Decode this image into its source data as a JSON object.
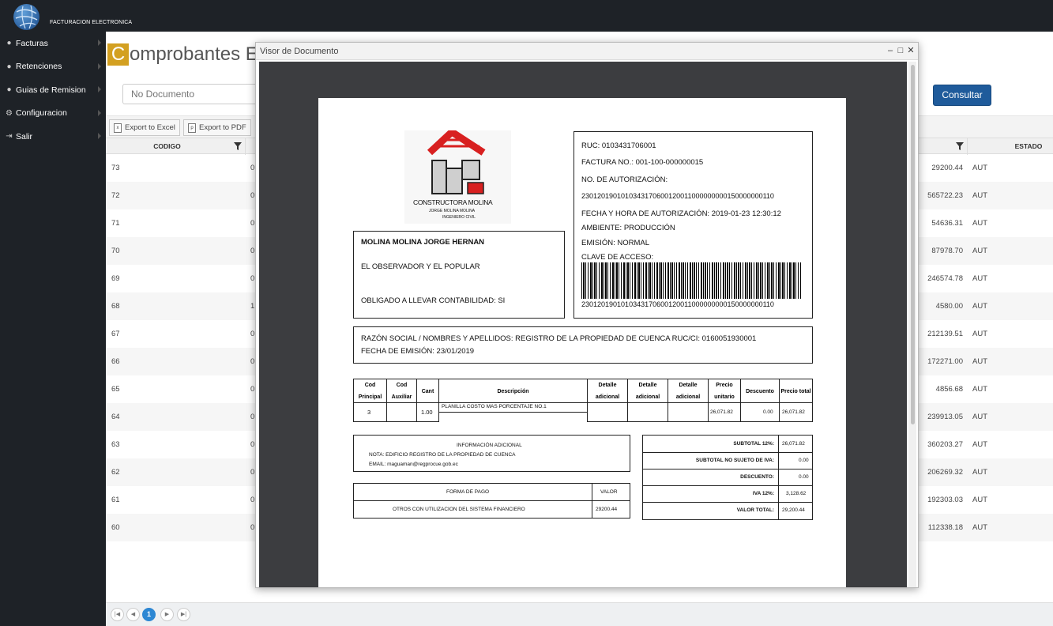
{
  "app": {
    "brand": "FACTURACION ELECTRONICA"
  },
  "sidebar": {
    "items": [
      {
        "label": "Facturas",
        "icon": "globe-icon"
      },
      {
        "label": "Retenciones",
        "icon": "globe-icon"
      },
      {
        "label": "Guias de Remision",
        "icon": "globe-icon"
      },
      {
        "label": "Configuracion",
        "icon": "gear-icon"
      },
      {
        "label": "Salir",
        "icon": "exit-icon"
      }
    ]
  },
  "page": {
    "title_initial": "C",
    "title_rest": "omprobantes E",
    "search_placeholder": "No Documento",
    "consultar_label": "Consultar",
    "export_excel": "Export to Excel",
    "export_pdf": "Export to PDF"
  },
  "grid": {
    "col_codigo": "CODIGO",
    "col_estado": "ESTADO",
    "rows": [
      {
        "codigo": "73",
        "doc": "0",
        "total": "29200.44",
        "estado": "AUT"
      },
      {
        "codigo": "72",
        "doc": "0",
        "total": "565722.23",
        "estado": "AUT"
      },
      {
        "codigo": "71",
        "doc": "0",
        "total": "54636.31",
        "estado": "AUT"
      },
      {
        "codigo": "70",
        "doc": "0",
        "total": "87978.70",
        "estado": "AUT"
      },
      {
        "codigo": "69",
        "doc": "0",
        "total": "246574.78",
        "estado": "AUT"
      },
      {
        "codigo": "68",
        "doc": "1",
        "total": "4580.00",
        "estado": "AUT"
      },
      {
        "codigo": "67",
        "doc": "0",
        "total": "212139.51",
        "estado": "AUT"
      },
      {
        "codigo": "66",
        "doc": "0",
        "total": "172271.00",
        "estado": "AUT"
      },
      {
        "codigo": "65",
        "doc": "0",
        "total": "4856.68",
        "estado": "AUT"
      },
      {
        "codigo": "64",
        "doc": "0",
        "total": "239913.05",
        "estado": "AUT"
      },
      {
        "codigo": "63",
        "doc": "0",
        "total": "360203.27",
        "estado": "AUT"
      },
      {
        "codigo": "62",
        "doc": "0",
        "total": "206269.32",
        "estado": "AUT"
      },
      {
        "codigo": "61",
        "doc": "0",
        "total": "192303.03",
        "estado": "AUT"
      },
      {
        "codigo": "60",
        "doc": "0",
        "total": "112338.18",
        "estado": "AUT"
      }
    ]
  },
  "pager": {
    "current": "1"
  },
  "modal": {
    "title": "Visor de Documento",
    "minimize": "–",
    "maximize": "□",
    "close": "✕"
  },
  "invoice": {
    "company_logo_name": "CONSTRUCTORA MOLINA",
    "company_logo_sub1": "JORGE MOLINA MOLINA",
    "company_logo_sub2": "INGENIERO CIVIL",
    "ruc": "RUC: 0103431706001",
    "factura_no": "FACTURA NO.: 001-100-000000015",
    "no_autorizacion_label": "NO. DE AUTORIZACIÓN:",
    "no_autorizacion": "2301201901010343170600120011000000000150000000110",
    "fecha_autorizacion": "FECHA Y HORA DE AUTORIZACIÓN: 2019-01-23 12:30:12",
    "ambiente": "AMBIENTE: PRODUCCIÓN",
    "emision": "EMISIÓN: NORMAL",
    "clave_label": "CLAVE DE ACCESO:",
    "clave": "2301201901010343170600120011000000000150000000110",
    "emisor_nombre": "MOLINA MOLINA JORGE HERNAN",
    "emisor_direccion": "EL OBSERVADOR Y EL POPULAR",
    "obligado": "OBLIGADO A LLEVAR CONTABILIDAD: SI",
    "razon_social": "RAZÓN SOCIAL / NOMBRES Y APELLIDOS:   REGISTRO DE LA PROPIEDAD DE CUENCA   RUC/CI:  0160051930001",
    "fecha_emision": "FECHA DE EMISIÓN: 23/01/2019",
    "detail_headers": {
      "cod_principal": "Cod Principal",
      "cod_auxiliar": "Cod Auxiliar",
      "cant": "Cant",
      "descripcion": "Descripción",
      "det1": "Detalle adicional",
      "det2": "Detalle adicional",
      "det3": "Detalle adicional",
      "precio_unitario": "Precio unitario",
      "descuento": "Descuento",
      "precio_total": "Precio total"
    },
    "detail_row": {
      "cod_principal": "3",
      "cant": "1.00",
      "descripcion": "PLANILLA COSTO MAS PORCENTAJE NO.1",
      "precio_unitario": "26,071.82",
      "descuento": "0.00",
      "precio_total": "26,071.82"
    },
    "info_adicional_title": "INFORMACIÓN ADICIONAL",
    "info_nota": "NOTA:  EDIFICIO REGISTRO DE LA PROPIEDAD DE CUENCA",
    "info_email": "EMAIL:  maguaman@regprocue.gob.ec",
    "forma_pago_label": "FORMA DE PAGO",
    "valor_label": "VALOR",
    "forma_pago": "OTROS CON UTILIZACION DEL SISTEMA FINANCIERO",
    "forma_pago_valor": "29200.44",
    "totals": [
      {
        "label": "SUBTOTAL 12%:",
        "value": "26,071.82"
      },
      {
        "label": "SUBTOTAL NO SUJETO DE IVA:",
        "value": "0.00"
      },
      {
        "label": "DESCUENTO:",
        "value": "0.00"
      },
      {
        "label": "IVA 12%:",
        "value": "3,128.62"
      },
      {
        "label": "VALOR TOTAL:",
        "value": "29,200.44"
      }
    ]
  },
  "colors": {
    "accent": "#d3a021",
    "primary_button": "#1f5b9b",
    "sidebar_bg": "#1e2227",
    "viewer_bg": "#3c3d40"
  }
}
